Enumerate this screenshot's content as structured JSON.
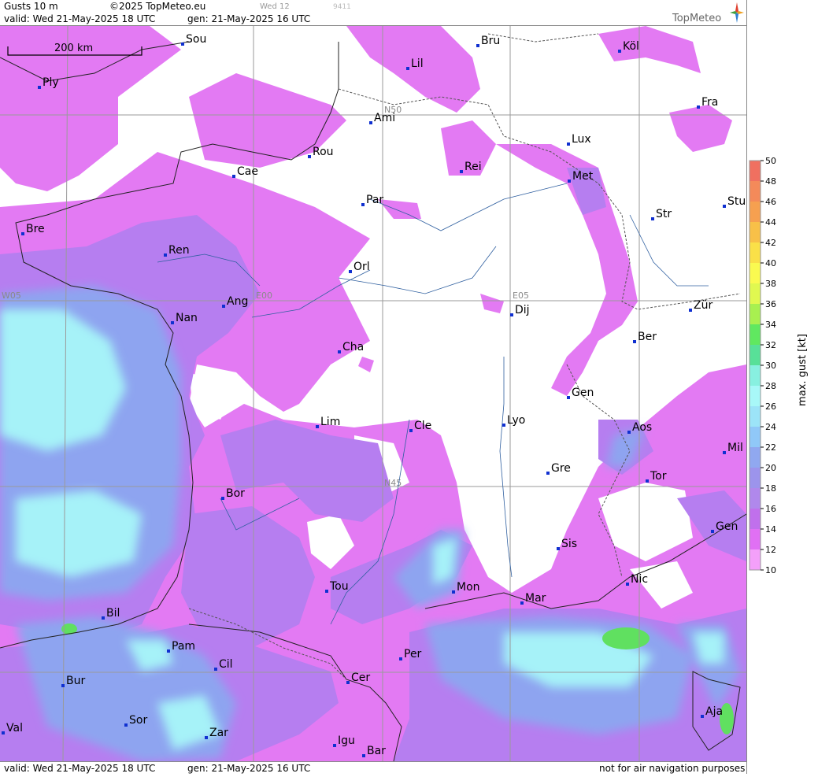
{
  "header": {
    "title": "Gusts 10 m",
    "copyright": "©2025 TopMeteo.eu",
    "day_tag": "Wed 12",
    "code": "9411",
    "valid": "valid:  Wed  21-May-2025  18 UTC",
    "gen": "gen: 21-May-2025 16 UTC",
    "brand": "TopMeteo"
  },
  "footer": {
    "valid": "valid:  Wed  21-May-2025  18 UTC",
    "gen": "gen: 21-May-2025 16 UTC",
    "disclaimer": "not for air navigation purposes"
  },
  "scale_bar": {
    "label": "200 km"
  },
  "grid_labels": {
    "n50": "N50",
    "n45": "N45",
    "w05": "W05",
    "e00": "E00",
    "e05": "E05"
  },
  "cities": [
    {
      "name": "Sou"
    },
    {
      "name": "Bru"
    },
    {
      "name": "Köl"
    },
    {
      "name": "Lil"
    },
    {
      "name": "Ply"
    },
    {
      "name": "Ami"
    },
    {
      "name": "Fra"
    },
    {
      "name": "Rou"
    },
    {
      "name": "Lux"
    },
    {
      "name": "Cae"
    },
    {
      "name": "Rei"
    },
    {
      "name": "Met"
    },
    {
      "name": "Par"
    },
    {
      "name": "Str"
    },
    {
      "name": "Stu"
    },
    {
      "name": "Bre"
    },
    {
      "name": "Ren"
    },
    {
      "name": "Orl"
    },
    {
      "name": "Ang"
    },
    {
      "name": "Dij"
    },
    {
      "name": "Zür"
    },
    {
      "name": "Nan"
    },
    {
      "name": "Ber"
    },
    {
      "name": "Cha"
    },
    {
      "name": "Gen"
    },
    {
      "name": "Lim"
    },
    {
      "name": "Cle"
    },
    {
      "name": "Lyo"
    },
    {
      "name": "Aos"
    },
    {
      "name": "Mil"
    },
    {
      "name": "Gre"
    },
    {
      "name": "Tor"
    },
    {
      "name": "Bor"
    },
    {
      "name": "Gen"
    },
    {
      "name": "Sis"
    },
    {
      "name": "Tou"
    },
    {
      "name": "Mon"
    },
    {
      "name": "Mar"
    },
    {
      "name": "Nic"
    },
    {
      "name": "Bil"
    },
    {
      "name": "Pam"
    },
    {
      "name": "Cil"
    },
    {
      "name": "Per"
    },
    {
      "name": "Cer"
    },
    {
      "name": "Bur"
    },
    {
      "name": "Sor"
    },
    {
      "name": "Ajа"
    },
    {
      "name": "Val"
    },
    {
      "name": "Zar"
    },
    {
      "name": "Igu"
    },
    {
      "name": "Bar"
    }
  ],
  "legend": {
    "title": "max. gust [kt]",
    "ticks": [
      "50",
      "48",
      "46",
      "44",
      "42",
      "40",
      "38",
      "36",
      "34",
      "32",
      "30",
      "28",
      "26",
      "24",
      "22",
      "20",
      "18",
      "16",
      "14",
      "12",
      "10"
    ],
    "colors": [
      "#f07060",
      "#f48a5a",
      "#f6a050",
      "#f8c048",
      "#fae048",
      "#fafa50",
      "#e0f850",
      "#a8f050",
      "#60e860",
      "#58e098",
      "#88f0e0",
      "#a8f8f8",
      "#9ce4f8",
      "#90c8f8",
      "#90a8f0",
      "#9c94ec",
      "#b088ec",
      "#c070ec",
      "#e070f4",
      "#f4a0fa"
    ]
  }
}
